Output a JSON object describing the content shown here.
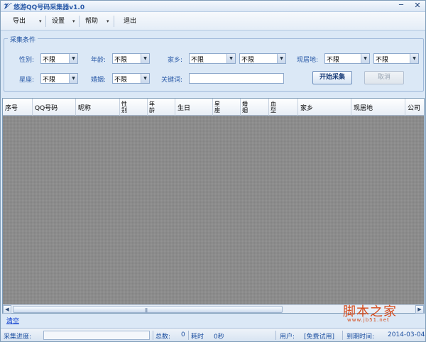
{
  "window": {
    "title": "悠游QQ号码采集器v1.0",
    "minimize_glyph": "─",
    "close_glyph": "✕"
  },
  "menu": {
    "items": [
      {
        "label": "导出",
        "has_dropdown": true
      },
      {
        "label": "设置",
        "has_dropdown": true
      },
      {
        "label": "帮助",
        "has_dropdown": true
      },
      {
        "label": "退出",
        "has_dropdown": false
      }
    ]
  },
  "filters": {
    "group_title": "采集条件",
    "gender": {
      "label": "性别:",
      "value": "不限"
    },
    "age": {
      "label": "年龄:",
      "value": "不限"
    },
    "hometown": {
      "label": "家乡:",
      "value1": "不限",
      "value2": "不限"
    },
    "residence": {
      "label": "现居地:",
      "value1": "不限",
      "value2": "不限"
    },
    "zodiac": {
      "label": "星座:",
      "value": "不限"
    },
    "marriage": {
      "label": "婚姻:",
      "value": "不限"
    },
    "keyword": {
      "label": "关键词:",
      "value": ""
    },
    "start_button": "开始采集",
    "cancel_button": "取消"
  },
  "grid": {
    "columns": [
      "序号",
      "QQ号码",
      "昵称",
      "性别",
      "年龄",
      "生日",
      "星座",
      "婚姻",
      "血型",
      "家乡",
      "现居地",
      "公司"
    ],
    "rows": []
  },
  "clear_link": "清空",
  "watermark": {
    "text": "脚本之家",
    "url": "www.jb51.net"
  },
  "status": {
    "progress_label": "采集进度:",
    "progress": 0,
    "total_label": "总数:",
    "total_value": "0",
    "elapsed_label": "耗时",
    "elapsed_value": "0秒",
    "user_label": "用户:",
    "user_value": "[免费试用]",
    "expiry_label": "到期时间:",
    "expiry_value": "2014-03-04"
  }
}
